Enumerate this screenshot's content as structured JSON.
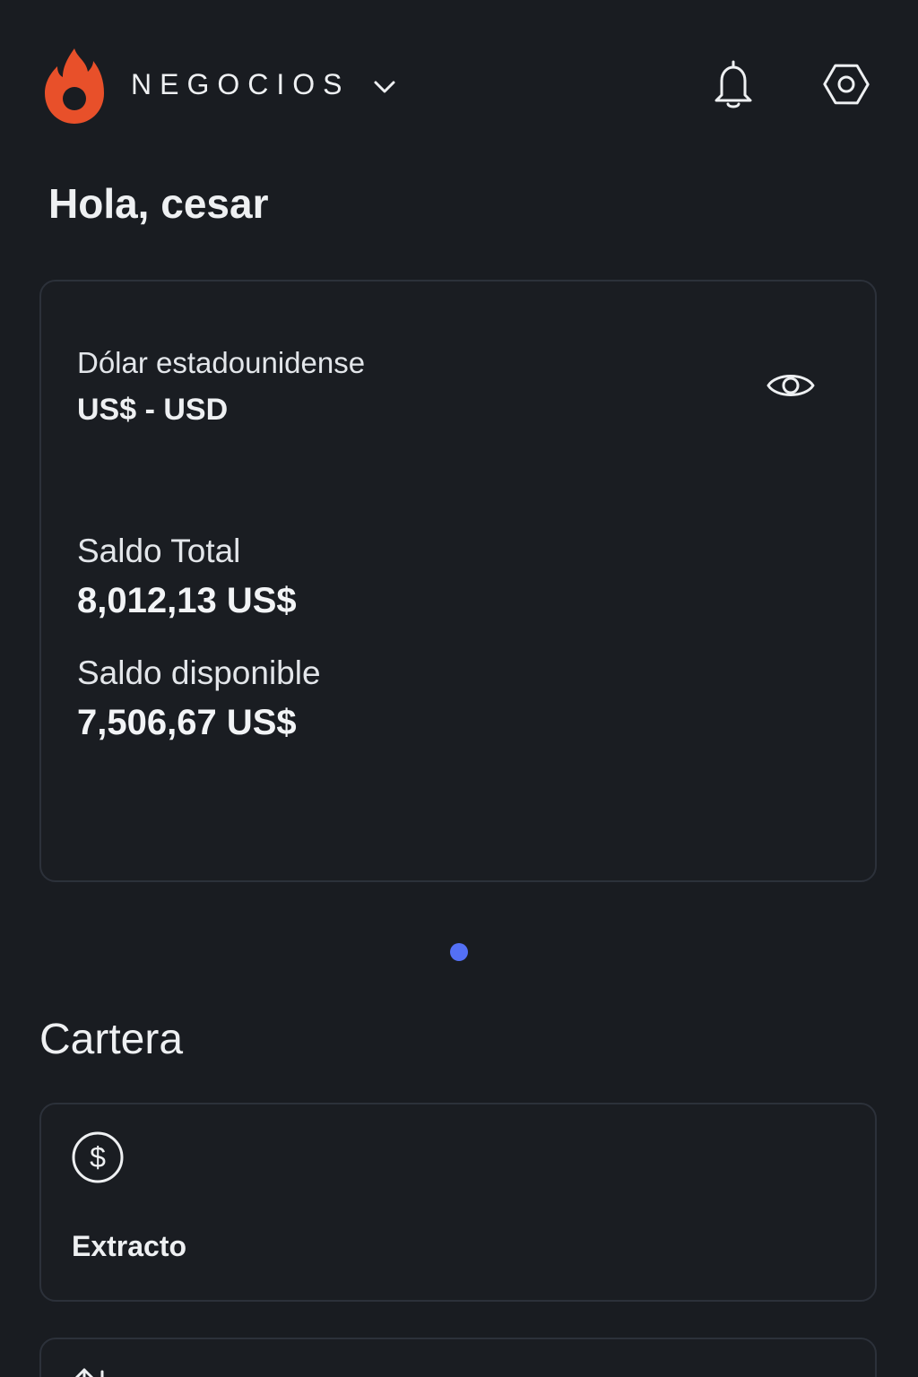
{
  "header": {
    "workspace_label": "NEGOCIOS",
    "icons": [
      "hotmart-flame-logo",
      "chevron-down-icon",
      "bell-icon",
      "settings-icon"
    ],
    "brand_color": "#e8502a"
  },
  "greeting": "Hola, cesar",
  "balance_card": {
    "currency_name": "Dólar estadounidense",
    "currency_code": "US$ - USD",
    "total_label": "Saldo Total",
    "total_value": "8,012,13 US$",
    "available_label": "Saldo disponible",
    "available_value": "7,506,67 US$",
    "icons": [
      "eye-icon"
    ]
  },
  "carousel": {
    "active_color": "#5470f5"
  },
  "wallet": {
    "title": "Cartera",
    "items": [
      {
        "label": "Extracto",
        "icon": "dollar-circle-icon"
      },
      {
        "label": "",
        "icon": "transfer-arrows-icon"
      }
    ]
  }
}
